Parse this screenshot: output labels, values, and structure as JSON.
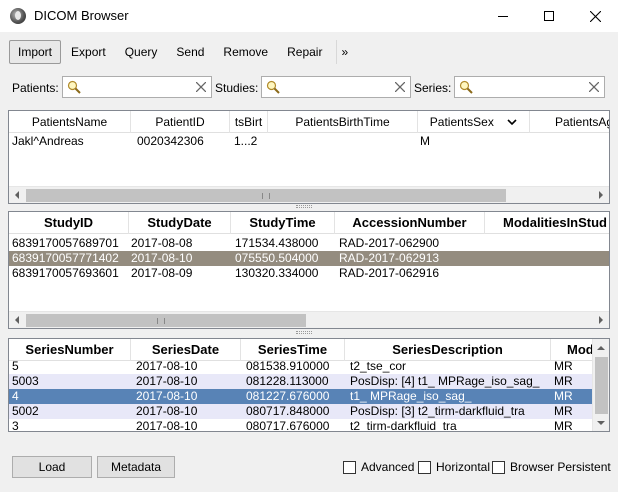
{
  "window": {
    "title": "DICOM Browser"
  },
  "toolbar": {
    "buttons": [
      "Import",
      "Export",
      "Query",
      "Send",
      "Remove",
      "Repair"
    ],
    "more": "»"
  },
  "search": {
    "patients_label": "Patients:",
    "studies_label": "Studies:",
    "series_label": "Series:",
    "patients_value": "",
    "studies_value": "",
    "series_value": ""
  },
  "patients": {
    "columns": [
      "PatientsName",
      "PatientID",
      "tsBirt",
      "PatientsBirthTime",
      "PatientsSex",
      "PatientsAg"
    ],
    "rows": [
      [
        "Jakl^Andreas",
        "0020342306",
        "1...2",
        "",
        "M",
        ""
      ]
    ]
  },
  "studies": {
    "columns": [
      "StudyID",
      "StudyDate",
      "StudyTime",
      "AccessionNumber",
      "ModalitiesInStud"
    ],
    "rows": [
      [
        "6839170057689701",
        "2017-08-08",
        "171534.438000",
        "RAD-2017-062900",
        ""
      ],
      [
        "6839170057771402",
        "2017-08-10",
        "075550.504000",
        "RAD-2017-062913",
        ""
      ],
      [
        "6839170057693601",
        "2017-08-09",
        "130320.334000",
        "RAD-2017-062916",
        ""
      ]
    ],
    "selected_index": 1
  },
  "series": {
    "columns": [
      "SeriesNumber",
      "SeriesDate",
      "SeriesTime",
      "SeriesDescription",
      "Mod"
    ],
    "rows": [
      [
        "5",
        "2017-08-10",
        "081538.910000",
        "t2_tse_cor",
        "MR"
      ],
      [
        "5003",
        "2017-08-10",
        "081228.113000",
        "PosDisp: [4] t1_ MPRage_iso_sag_",
        "MR"
      ],
      [
        "4",
        "2017-08-10",
        "081227.676000",
        "t1_ MPRage_iso_sag_",
        "MR"
      ],
      [
        "5002",
        "2017-08-10",
        "080717.848000",
        "PosDisp: [3] t2_tirm-darkfluid_tra",
        "MR"
      ],
      [
        "3",
        "2017-08-10",
        "080717.676000",
        "t2_tirm-darkfluid_tra",
        "MR"
      ]
    ],
    "selected_index": 2
  },
  "bottom": {
    "load": "Load",
    "metadata": "Metadata",
    "advanced": "Advanced",
    "horizontal": "Horizontal",
    "browser_persistent": "Browser Persistent"
  },
  "colors": {
    "study_selection": "#948c7f",
    "series_selection": "#5883b6",
    "series_alt_row": "#e8e8f8"
  }
}
